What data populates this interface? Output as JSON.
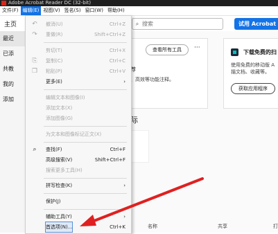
{
  "window": {
    "title": "Adobe Acrobat Reader DC (32-bit)"
  },
  "menubar": {
    "items": [
      "文件(F)",
      "编辑(E)",
      "视图(V)",
      "签名(S)",
      "窗口(W)",
      "帮助(H)"
    ]
  },
  "toolbar": {
    "home_tab": "主页",
    "search_placeholder": "搜索",
    "try_button": "试用 Acrobat Pro"
  },
  "sidebar": {
    "items": [
      "最近",
      "已添",
      "共教",
      "我的",
      "添加"
    ]
  },
  "main": {
    "see_all_tools": "查看所有工具",
    "more": "···",
    "fragment_1": "荐",
    "fragment_2": "、高效等功能注释。",
    "fragment_3": "际",
    "download_title": "下载免费的扫",
    "download_desc_1": "使用免费的移动版 A",
    "download_desc_2": "描文档、收藏等。",
    "get_app": "获取应用程序",
    "columns": {
      "name": "名称",
      "share": "共享",
      "open": "打"
    }
  },
  "edit_menu": {
    "undo": {
      "label": "撤消(U)",
      "shortcut": "Ctrl+Z"
    },
    "redo": {
      "label": "重做(R)",
      "shortcut": "Shift+Ctrl+Z"
    },
    "cut": {
      "label": "剪切(T)",
      "shortcut": "Ctrl+X"
    },
    "copy": {
      "label": "复制(C)",
      "shortcut": "Ctrl+C"
    },
    "paste": {
      "label": "粘贴(P)",
      "shortcut": "Ctrl+V"
    },
    "more": {
      "label": "更多(E)"
    },
    "edit_text_images": {
      "label": "编辑文本和图像(I)"
    },
    "add_text": {
      "label": "添加文本(X)"
    },
    "add_image": {
      "label": "添加图像(G)"
    },
    "tag_text": {
      "label": "为文本和图像标记正文(X)"
    },
    "find": {
      "label": "查找(F)",
      "shortcut": "Ctrl+F"
    },
    "advanced_search": {
      "label": "高级搜索(V)",
      "shortcut": "Shift+Ctrl+F"
    },
    "search_more": {
      "label": "搜索更多工具(H)"
    },
    "spell_check": {
      "label": "拼写检查(K)"
    },
    "protection": {
      "label": "保护(J)"
    },
    "accessibility": {
      "label": "辅助工具(Y)"
    },
    "preferences": {
      "label": "首选项(N)...",
      "shortcut": "Ctrl+K"
    }
  },
  "colors": {
    "accent": "#1473e6",
    "annotation_arrow": "#e02020"
  }
}
